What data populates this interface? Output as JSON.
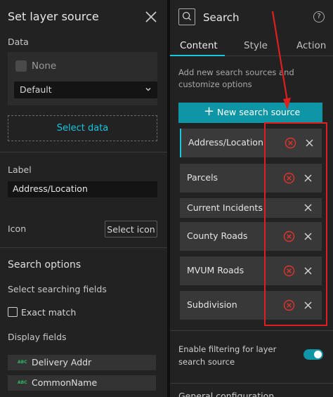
{
  "left_panel": {
    "title": "Set layer source",
    "data_section": {
      "label": "Data",
      "none_text": "None",
      "dropdown_value": "Default",
      "select_data_label": "Select data"
    },
    "label_section": {
      "label": "Label",
      "value": "Address/Location"
    },
    "icon_section": {
      "label": "Icon",
      "button_label": "Select icon"
    },
    "search_options": {
      "heading": "Search options",
      "searching_fields_label": "Select searching fields",
      "exact_match_label": "Exact match",
      "display_fields_label": "Display fields",
      "fields": [
        {
          "type_badge": "ABC",
          "name": "Delivery Addr"
        },
        {
          "type_badge": "ABC",
          "name": "CommonName"
        }
      ]
    }
  },
  "right_panel": {
    "title": "Search",
    "help_glyph": "?",
    "tabs": [
      {
        "label": "Content",
        "active": true
      },
      {
        "label": "Style",
        "active": false
      },
      {
        "label": "Action",
        "active": false
      }
    ],
    "description": "Add new search sources and customize options",
    "new_source_button": {
      "icon": "+",
      "label": "New search source"
    },
    "sources": [
      {
        "label": "Address/Location",
        "selected": true,
        "has_remove_icon": true
      },
      {
        "label": "Parcels",
        "selected": false,
        "has_remove_icon": true
      },
      {
        "label": "Current Incidents",
        "selected": false,
        "has_remove_icon": false
      },
      {
        "label": "County Roads",
        "selected": false,
        "has_remove_icon": true
      },
      {
        "label": "MVUM Roads",
        "selected": false,
        "has_remove_icon": true
      },
      {
        "label": "Subdivision",
        "selected": false,
        "has_remove_icon": true
      }
    ],
    "filter_label": "Enable filtering for layer search source",
    "filter_enabled": true,
    "cut_off_text": "General configuration"
  },
  "colors": {
    "accent": "#19c6e0",
    "button_bg": "#0e96a6",
    "annotation_red": "#e01e1e",
    "remove_icon_red": "#e0342c"
  }
}
